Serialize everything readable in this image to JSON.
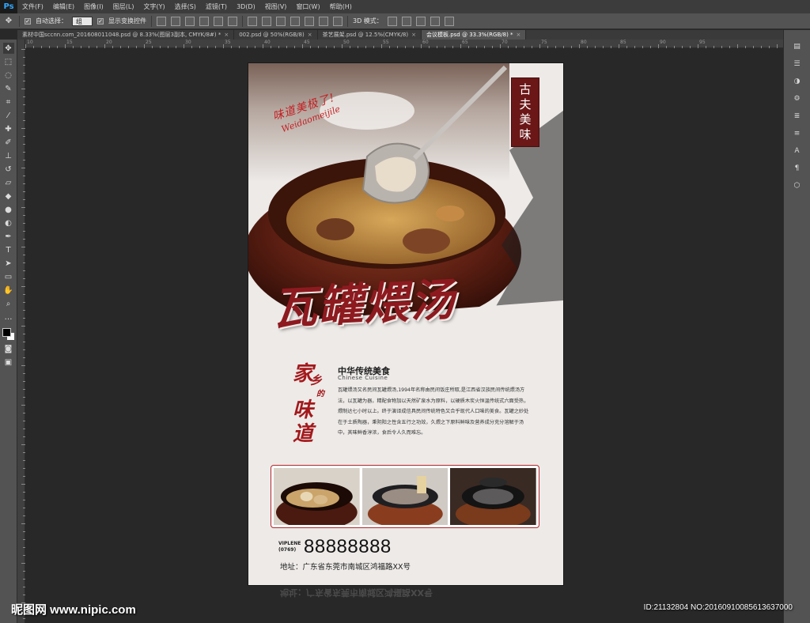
{
  "app": {
    "logo": "Ps"
  },
  "menu": [
    "文件(F)",
    "编辑(E)",
    "图像(I)",
    "图层(L)",
    "文字(Y)",
    "选择(S)",
    "滤镜(T)",
    "3D(D)",
    "视图(V)",
    "窗口(W)",
    "帮助(H)"
  ],
  "options": {
    "auto_select_label": "自动选择：",
    "auto_select_value": "组",
    "show_transform_label": "显示变换控件",
    "mode_3d_label": "3D 模式："
  },
  "tabs": [
    {
      "label": "素材中国sccnn.com_201608011048.psd @ 8.33%(图层3副本, CMYK/8#) *"
    },
    {
      "label": "002.psd @ 50%(RGB/8)"
    },
    {
      "label": "茶艺展架.psd @ 12.5%(CMYK/8)"
    },
    {
      "label": "会议模板.psd @ 33.3%(RGB/8) *"
    }
  ],
  "ruler": {
    "top_labels": [
      "10",
      "15",
      "20",
      "25",
      "30",
      "35",
      "40",
      "45",
      "50",
      "55",
      "60",
      "65",
      "70",
      "75",
      "80",
      "85",
      "90",
      "95"
    ]
  },
  "poster": {
    "seal": [
      "古",
      "夫",
      "美",
      "味"
    ],
    "slogan_cn": "味道美极了!",
    "slogan_en": "Weidaomeijile",
    "main_title": "瓦罐煨汤",
    "vertical_title_a": "家",
    "vertical_title_b": "乡",
    "vertical_title_c": "的",
    "vertical_title_d": "味道",
    "subtitle_cn": "中华传统美食",
    "subtitle_en": "Chinese  Cuisine",
    "description": "瓦罐煨汤又名民间瓦罐煨汤,1994年名称由民间饭庄所取,是江西省汉族民间传统煨汤方法，以瓦罐为器，精配食物加以天然矿泉水为原料，以硬质木炭火恒温传统式六面受热，煨制达七小时以上。终于演译成信具民间传统特色又合乎现代人口味的美食。瓦罐之妙处在于土质陶器，秉阴阳之性含五行之功效，久煨之下原料鲜味及营养成分充分溶解于汤中，其味鲜香淳浓，食后令人久而难忘。",
    "phone_label_1": "VIPLENE",
    "phone_label_2": "(0769)",
    "phone_number": "88888888",
    "address": "地址：广东省东莞市南城区鸿福路XX号",
    "reflection": "地址：广东省东莞市南城区鸿福路XX号"
  },
  "watermark": {
    "left": "昵图网 www.nipic.com",
    "right": "ID:21132804 NO:20160910085613637000"
  },
  "colors": {
    "accent_red": "#8d1a1f",
    "ps_blue": "#31a8ff"
  }
}
